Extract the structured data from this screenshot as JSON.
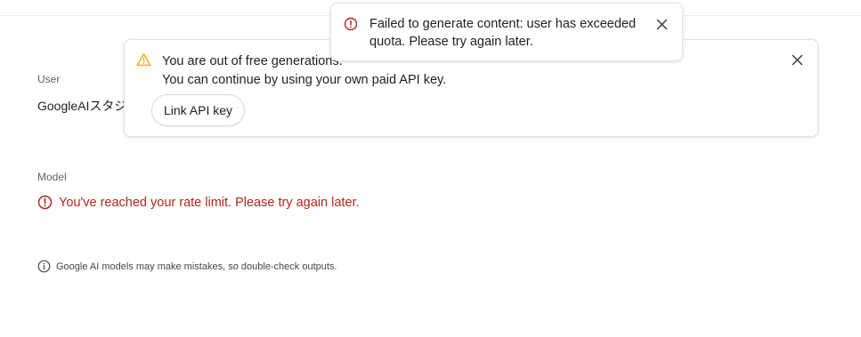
{
  "form": {
    "user_label": "User",
    "user_value": "GoogleAIスタジ",
    "model_label": "Model",
    "model_error": "You've reached your rate limit. Please try again later.",
    "disclaimer": "Google AI models may make mistakes, so double-check outputs."
  },
  "quota_notice": {
    "line1": "You are out of free generations.",
    "line2": "You can continue by using your own paid API key.",
    "button_label": "Link API key",
    "icon": "warning-icon"
  },
  "toast": {
    "message": "Failed to generate content: user has exceeded quota. Please try again later.",
    "icon": "error-icon"
  },
  "colors": {
    "error": "#b3261e",
    "warning": "#f2b01e",
    "text": "#1f1f1f",
    "muted": "#5f6368"
  }
}
